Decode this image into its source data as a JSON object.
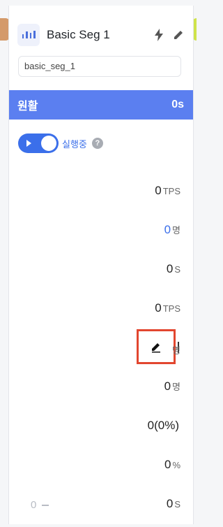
{
  "segment": {
    "title": "Basic Seg 1",
    "id": "basic_seg_1"
  },
  "status": {
    "label": "원활",
    "time": "0s",
    "color": "#5b7ff0"
  },
  "toggle": {
    "label": "실행중",
    "on": true,
    "help": "?"
  },
  "metrics": [
    {
      "value": "0",
      "unit": "TPS"
    },
    {
      "value": "0",
      "unit": "명",
      "value_color": "#3b6fea"
    },
    {
      "value": "0",
      "unit": "S"
    },
    {
      "value": "0",
      "unit": "TPS"
    },
    {
      "value": "",
      "unit": "명",
      "editing": true
    },
    {
      "value": "0",
      "unit": "명"
    },
    {
      "value": "0(0%)",
      "unit": ""
    },
    {
      "value": "0",
      "unit": "%"
    },
    {
      "value": "0",
      "unit": "S"
    }
  ],
  "footer": {
    "left_value": "0"
  },
  "icons": [
    "bar-chart-icon",
    "lightning-icon",
    "pencil-icon",
    "pencil-icon",
    "help-icon"
  ],
  "colors": {
    "accent": "#3b6fea",
    "highlight": "#e2462f"
  }
}
